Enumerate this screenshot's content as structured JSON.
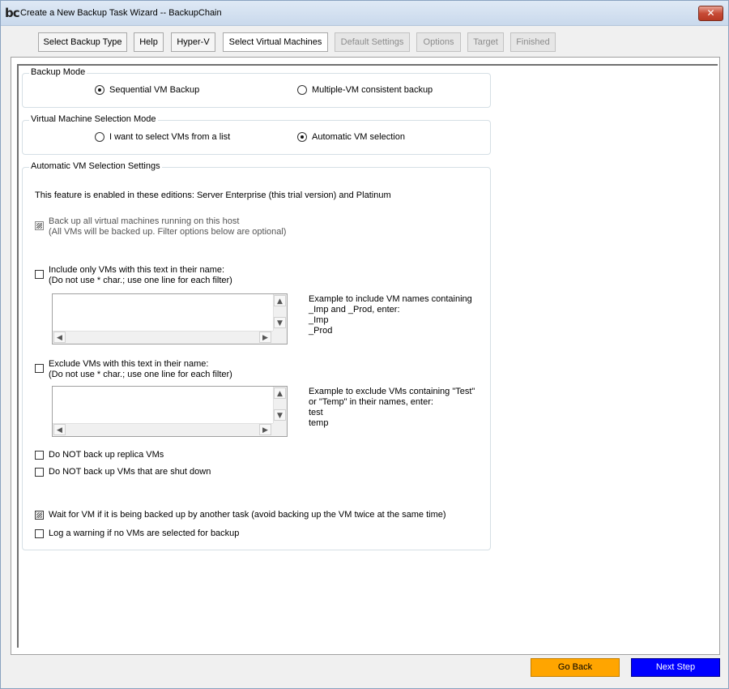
{
  "window": {
    "logo_text": "bc",
    "title": "Create a New Backup Task Wizard -- BackupChain",
    "close_label": "✕"
  },
  "tabs": [
    {
      "label": "Select Backup Type",
      "state": "normal"
    },
    {
      "label": "Help",
      "state": "normal"
    },
    {
      "label": "Hyper-V",
      "state": "normal"
    },
    {
      "label": "Select Virtual Machines",
      "state": "active"
    },
    {
      "label": "Default Settings",
      "state": "disabled"
    },
    {
      "label": "Options",
      "state": "disabled"
    },
    {
      "label": "Target",
      "state": "disabled"
    },
    {
      "label": "Finished",
      "state": "disabled"
    }
  ],
  "backup_mode": {
    "title": "Backup Mode",
    "options": [
      {
        "label": "Sequential VM Backup",
        "selected": true
      },
      {
        "label": "Multiple-VM consistent backup",
        "selected": false
      }
    ]
  },
  "selection_mode": {
    "title": "Virtual Machine Selection Mode",
    "options": [
      {
        "label": "I want to select VMs from a list",
        "selected": false
      },
      {
        "label": "Automatic VM selection",
        "selected": true
      }
    ]
  },
  "auto_settings": {
    "title": "Automatic VM Selection Settings",
    "edition_note": "This feature is enabled in these editions: Server Enterprise (this trial version) and Platinum",
    "backup_all": {
      "checked": true,
      "line1": "Back up all virtual machines running on this host",
      "line2": "(All VMs will be backed up. Filter options below are optional)"
    },
    "include": {
      "checked": false,
      "line1": "Include only VMs with this text in their name:",
      "line2": "(Do not use * char.; use one line for each filter)",
      "value": "",
      "example": [
        "Example to include VM names containing",
        "_Imp and _Prod, enter:",
        "_Imp",
        "_Prod"
      ]
    },
    "exclude": {
      "checked": false,
      "line1": "Exclude VMs with this text in their name:",
      "line2": "(Do not use * char.; use one line for each filter)",
      "value": "",
      "example": [
        "Example to exclude VMs containing \"Test\"",
        "or \"Temp\" in their names, enter:",
        "test",
        "temp"
      ]
    },
    "no_replica": {
      "checked": false,
      "label": "Do NOT back up replica VMs"
    },
    "no_shutdown": {
      "checked": false,
      "label": "Do NOT back up VMs that are shut down"
    },
    "wait_vm": {
      "checked": true,
      "label": "Wait for VM if it is being backed up by another task (avoid backing up the VM twice at the same time)"
    },
    "log_warning": {
      "checked": false,
      "label": "Log a warning if no VMs are selected for backup"
    }
  },
  "scroll_glyphs": {
    "up": "▲",
    "down": "▼",
    "left": "◀",
    "right": "▶"
  },
  "buttons": {
    "back": "Go Back",
    "next": "Next Step"
  },
  "colors": {
    "back_button": "#ffa500",
    "next_button": "#0000ff"
  }
}
